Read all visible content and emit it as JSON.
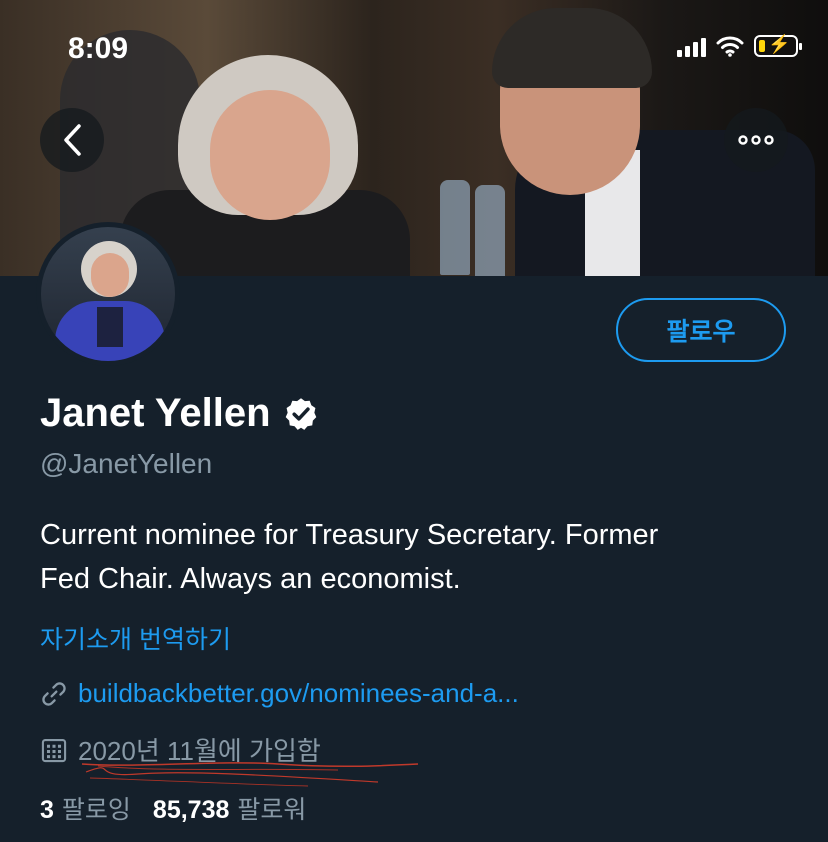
{
  "status_bar": {
    "time": "8:09"
  },
  "header": {
    "back_icon": "chevron-left-icon",
    "more_icon": "more-horizontal-icon"
  },
  "profile": {
    "name": "Janet Yellen",
    "handle": "@JanetYellen",
    "verified": true,
    "follow_label": "팔로우",
    "bio_lines": [
      "Current nominee for Treasury Secretary. Former",
      "Fed Chair. Always an economist."
    ],
    "translate_bio": "자기소개 번역하기",
    "website": "buildbackbetter.gov/nominees-and-a...",
    "joined": "2020년 11월에 가입함",
    "following_count": "3",
    "following_label": "팔로잉",
    "followers_count": "85,738",
    "followers_label": "팔로워"
  },
  "colors": {
    "background": "#15202b",
    "accent": "#1d9bf0",
    "secondary_text": "#8899a6",
    "scribble": "#c0392b"
  }
}
